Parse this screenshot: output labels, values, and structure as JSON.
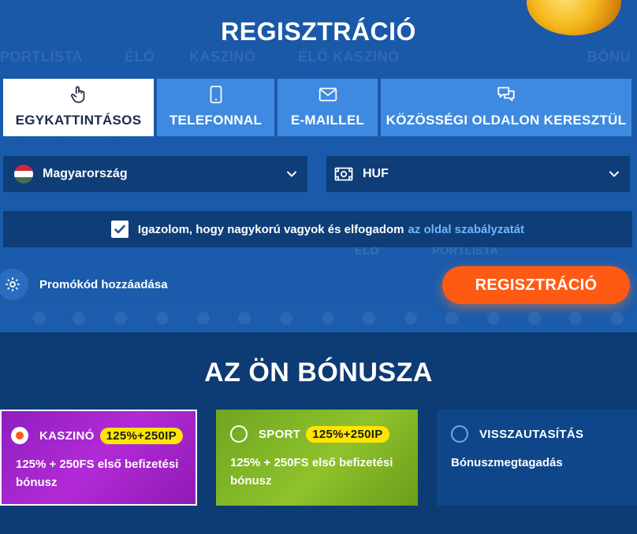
{
  "registration": {
    "title": "REGISZTRÁCIÓ",
    "background_nav": [
      "PORTLISTA",
      "ÉLŐ",
      "KASZINÓ",
      "ÉLŐ KASZINÓ",
      "",
      "BÓNU"
    ],
    "background_mid": [
      "ÉLŐ",
      "PORTLISTA"
    ],
    "tabs": [
      {
        "label": "EGYKATTINTÁSOS",
        "icon": "hand-pointer-icon",
        "active": true
      },
      {
        "label": "TELEFONNAL",
        "icon": "phone-icon",
        "active": false
      },
      {
        "label": "E-MAILLEL",
        "icon": "envelope-icon",
        "active": false
      },
      {
        "label": "KÖZÖSSÉGI OLDALON KERESZTÜL",
        "icon": "chat-icon",
        "active": false
      }
    ],
    "country_select": {
      "value": "Magyarország",
      "icon": "hungary-flag-icon"
    },
    "currency_select": {
      "value": "HUF",
      "icon": "banknote-icon"
    },
    "confirm": {
      "text": "Igazolom, hogy nagykorú vagyok és elfogadom",
      "link": "az oldal szabályzatát",
      "checked": true
    },
    "promo_label": "Promókód hozzáadása",
    "submit_label": "REGISZTRÁCIÓ"
  },
  "bonus": {
    "title": "AZ ÖN BÓNUSZA",
    "cards": [
      {
        "name": "KASZINÓ",
        "badge": "125%+250IP",
        "desc": "125% + 250FS első befizetési bónusz",
        "selected": true
      },
      {
        "name": "SPORT",
        "badge": "125%+250IP",
        "desc": "125% + 250FS első befizetési bónusz",
        "selected": false
      },
      {
        "name": "VISSZAUTASÍTÁS",
        "badge": "",
        "desc": "Bónuszmegtagadás",
        "selected": false
      }
    ]
  },
  "colors": {
    "brand_blue": "#1a58a8",
    "tab_blue": "#3e8ae0",
    "accent_orange": "#ff5a14",
    "badge_yellow": "#ffe600",
    "link_blue": "#6fb6ff"
  }
}
